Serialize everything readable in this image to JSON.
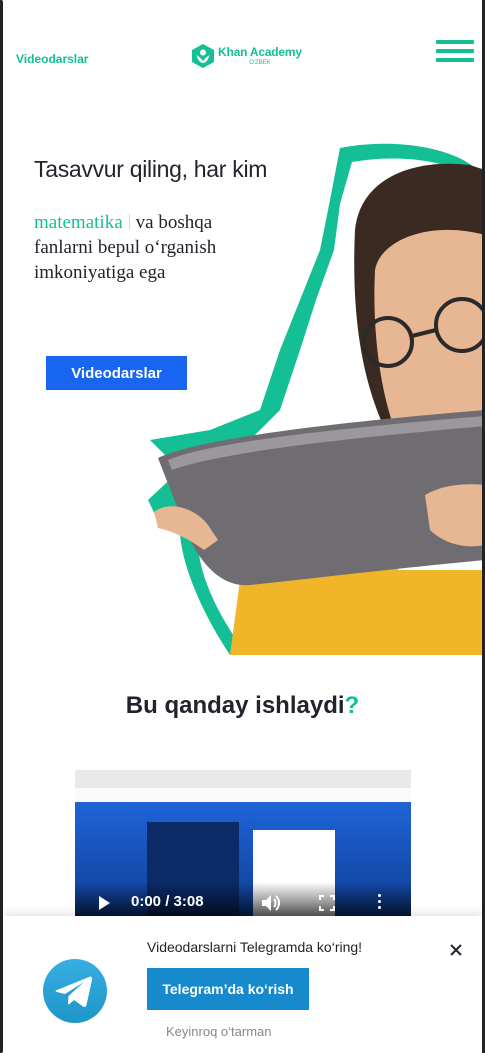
{
  "header": {
    "nav_link": "Videodarslar",
    "logo_name": "Khan Academy",
    "logo_sub": "O'ZBEK"
  },
  "hero": {
    "title": "Tasavvur qiling, har kim",
    "highlight": "matematika",
    "text": "va boshqa fanlarni bepul o‘rganish imkoniyatiga ega",
    "button_label": "Videodarslar"
  },
  "how": {
    "title": "Bu qanday ishlaydi",
    "question_mark": "?"
  },
  "video": {
    "time": "0:00 / 3:08"
  },
  "telegram_popup": {
    "message": "Videodarslarni Telegramda ko‘ring!",
    "button_label": "Telegram’da ko‘rish",
    "later_label": "Keyinroq o‘tarman"
  },
  "colors": {
    "accent": "#14bf96",
    "primary_button": "#1865f2",
    "telegram_button": "#168acd"
  }
}
